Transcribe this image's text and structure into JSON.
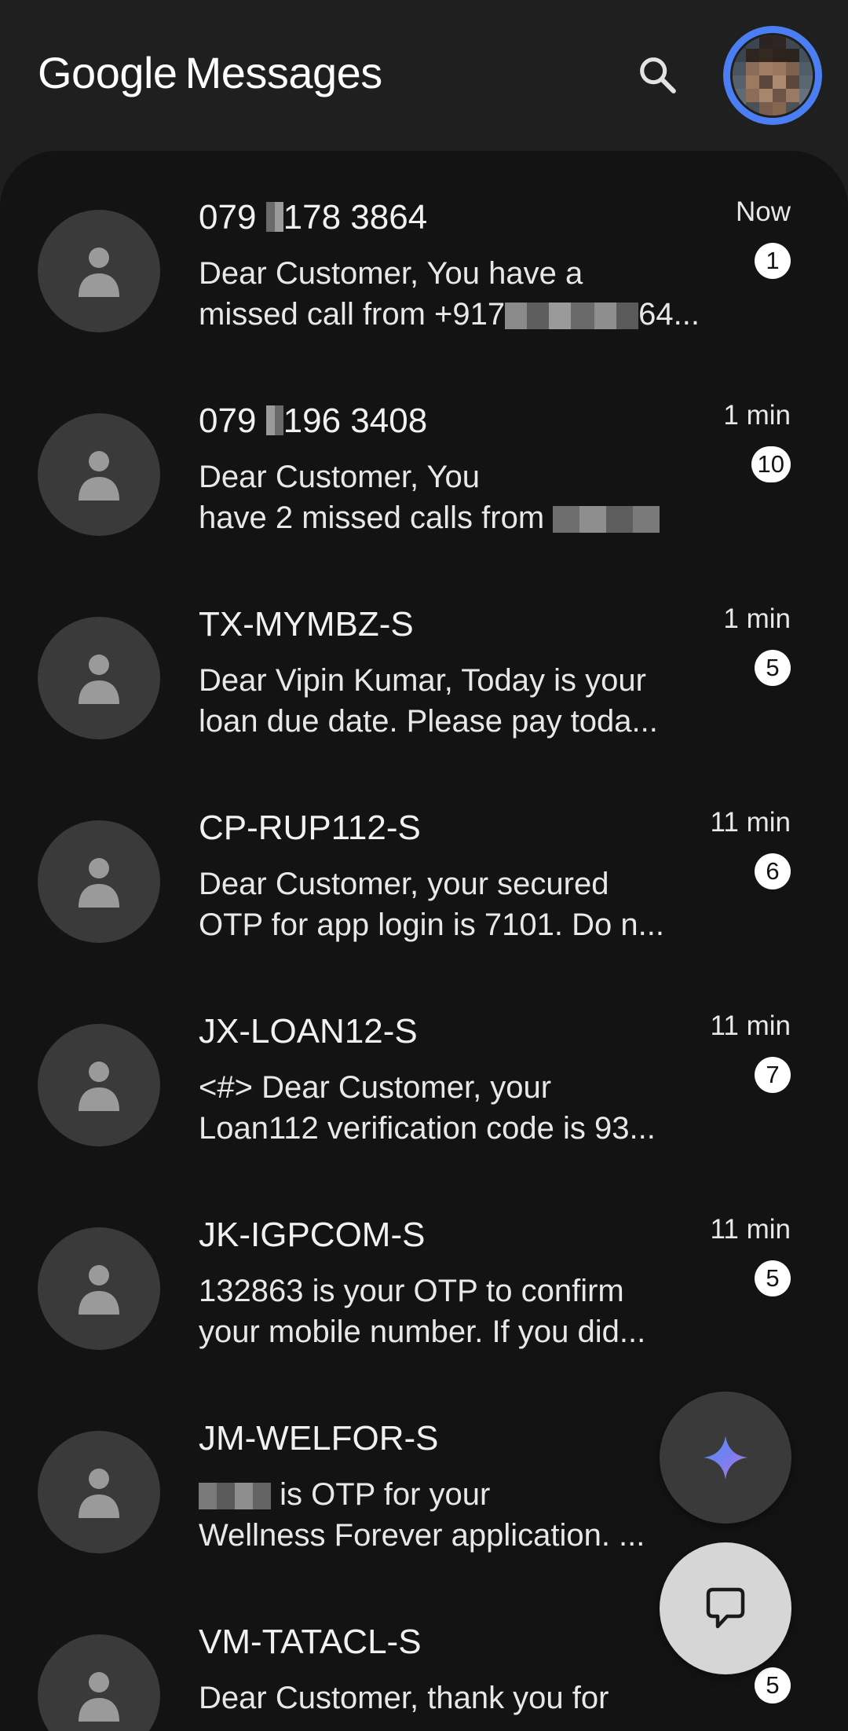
{
  "header": {
    "brand_google": "Google",
    "brand_product": "Messages",
    "search_icon": "search-icon",
    "avatar": "account-avatar"
  },
  "conversations": [
    {
      "name_pre": "079 ",
      "name_post": "178 3864",
      "line1": "Dear Customer, You have a",
      "line2_pre": "missed call from +917",
      "line2_post": "64...",
      "time": "Now",
      "unread": "1"
    },
    {
      "name_pre": "079 ",
      "name_post": "196 3408",
      "line1": "Dear Customer, You",
      "line2_pre": "have 2 missed calls from ",
      "line2_post": "",
      "time": "1 min",
      "unread": "10"
    },
    {
      "name": "TX-MYMBZ-S",
      "line1": "Dear Vipin Kumar, Today is your",
      "line2": "loan due date. Please pay toda...",
      "time": "1 min",
      "unread": "5"
    },
    {
      "name": "CP-RUP112-S",
      "line1": "Dear Customer, your secured",
      "line2": "OTP for app login is 7101. Do n...",
      "time": "11 min",
      "unread": "6"
    },
    {
      "name": "JX-LOAN12-S",
      "line1": "<#> Dear Customer, your",
      "line2": "Loan112 verification code is 93...",
      "time": "11 min",
      "unread": "7"
    },
    {
      "name": "JK-IGPCOM-S",
      "line1": "132863 is your OTP to confirm",
      "line2": "your mobile number. If you did...",
      "time": "11 min",
      "unread": "5"
    },
    {
      "name": "JM-WELFOR-S",
      "line1_post": " is OTP for your",
      "line2": "Wellness Forever application. ...",
      "time": "",
      "unread": ""
    },
    {
      "name": "VM-TATACL-S",
      "line1": "Dear Customer, thank you for",
      "time": "",
      "unread": "5"
    }
  ],
  "fabs": {
    "gemini_icon": "gemini-sparkle-icon",
    "compose_icon": "chat-bubble-icon"
  },
  "colors": {
    "header_bg": "#1f1f1f",
    "list_bg": "#131313",
    "avatar_ring": "#4a7ef2",
    "badge_bg": "#ffffff",
    "gemini_fab_bg": "#3a3a3a",
    "compose_fab_bg": "#d6d6d6"
  }
}
